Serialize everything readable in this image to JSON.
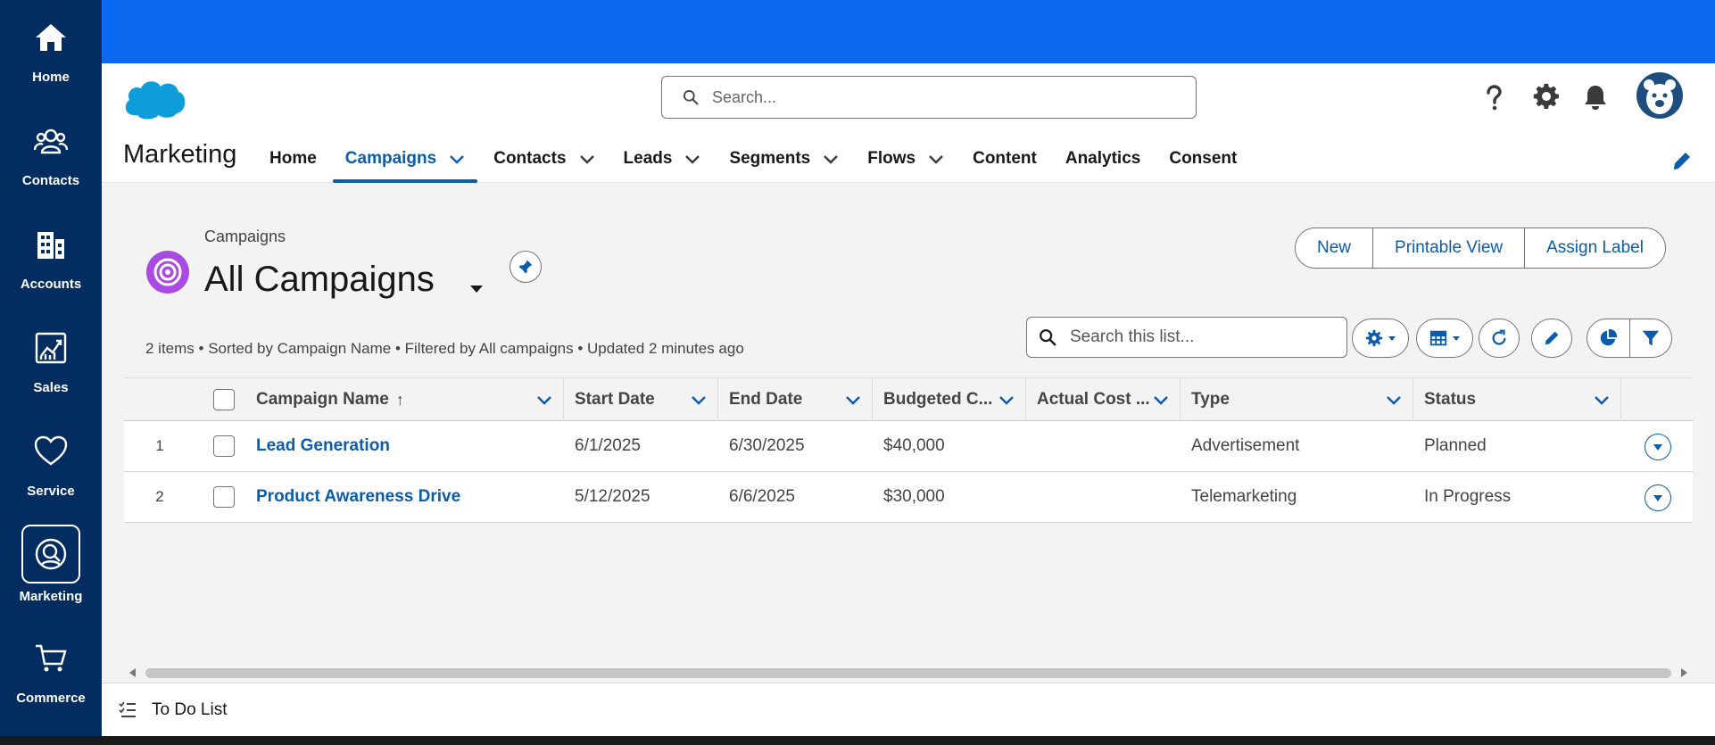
{
  "rail": {
    "items": [
      {
        "label": "Home",
        "icon": "home-icon"
      },
      {
        "label": "Contacts",
        "icon": "contacts-icon"
      },
      {
        "label": "Accounts",
        "icon": "building-icon"
      },
      {
        "label": "Sales",
        "icon": "chart-icon"
      },
      {
        "label": "Service",
        "icon": "heart-icon"
      },
      {
        "label": "Marketing",
        "icon": "marketing-icon",
        "active": true
      },
      {
        "label": "Commerce",
        "icon": "cart-icon"
      }
    ]
  },
  "header": {
    "search_placeholder": "Search...",
    "app_name": "Marketing",
    "nav": [
      {
        "label": "Home"
      },
      {
        "label": "Campaigns",
        "active": true,
        "dropdown": true
      },
      {
        "label": "Contacts",
        "dropdown": true
      },
      {
        "label": "Leads",
        "dropdown": true
      },
      {
        "label": "Segments",
        "dropdown": true
      },
      {
        "label": "Flows",
        "dropdown": true
      },
      {
        "label": "Content"
      },
      {
        "label": "Analytics"
      },
      {
        "label": "Consent"
      }
    ]
  },
  "list_view": {
    "breadcrumb": "Campaigns",
    "title": "All Campaigns",
    "buttons": {
      "new": "New",
      "printable": "Printable View",
      "assign": "Assign Label"
    },
    "summary": "2 items • Sorted by Campaign Name • Filtered by All campaigns • Updated 2 minutes ago",
    "search_placeholder": "Search this list..."
  },
  "table": {
    "columns": [
      "Campaign Name",
      "Start Date",
      "End Date",
      "Budgeted C...",
      "Actual Cost ...",
      "Type",
      "Status"
    ],
    "rows": [
      {
        "num": "1",
        "name": "Lead Generation",
        "start": "6/1/2025",
        "end": "6/30/2025",
        "budget": "$40,000",
        "actual": "",
        "type": "Advertisement",
        "status": "Planned"
      },
      {
        "num": "2",
        "name": "Product Awareness Drive",
        "start": "5/12/2025",
        "end": "6/6/2025",
        "budget": "$30,000",
        "actual": "",
        "type": "Telemarketing",
        "status": "In Progress"
      }
    ]
  },
  "utility_bar": {
    "todo": "To Do List"
  },
  "colors": {
    "rail": "#032d60",
    "topband": "#0b68f0",
    "link": "#0b5cab",
    "campaign_icon": "#a94be2"
  }
}
